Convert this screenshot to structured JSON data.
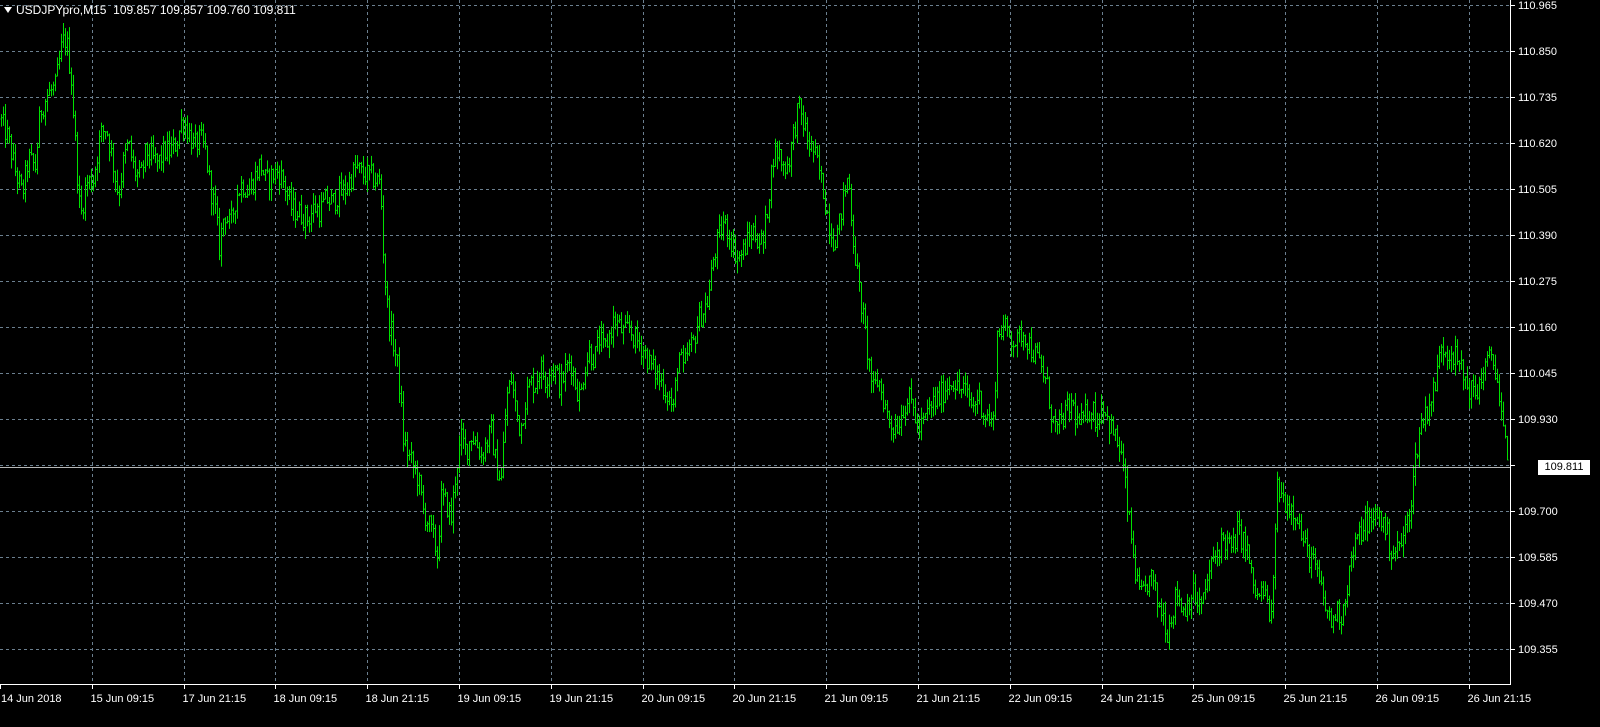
{
  "header": {
    "symbol": "USDJPYpro,M15",
    "ohlc": "109.857 109.857 109.760 109.811"
  },
  "colors": {
    "background": "#000000",
    "grid": "#6b7f8f",
    "candles": "#00e000",
    "axis_text": "#ffffff",
    "current_price_line": "#b8b8b8"
  },
  "chart_data": {
    "type": "bar",
    "instrument": "USDJPYpro",
    "timeframe": "M15",
    "ylim": [
      109.32,
      110.97
    ],
    "y_ticks": [
      "110.965",
      "110.850",
      "110.735",
      "110.620",
      "110.505",
      "110.390",
      "110.275",
      "110.160",
      "110.045",
      "109.930",
      "109.700",
      "109.585",
      "109.470",
      "109.355"
    ],
    "current_price": "109.811",
    "x_ticks": [
      "14 Jun 2018",
      "15 Jun 09:15",
      "17 Jun 21:15",
      "18 Jun 09:15",
      "18 Jun 21:15",
      "19 Jun 09:15",
      "19 Jun 21:15",
      "20 Jun 09:15",
      "20 Jun 21:15",
      "21 Jun 09:15",
      "21 Jun 21:15",
      "22 Jun 09:15",
      "24 Jun 21:15",
      "25 Jun 09:15",
      "25 Jun 21:15",
      "26 Jun 09:15",
      "26 Jun 21:15"
    ],
    "grid": true,
    "price_path": [
      [
        0,
        110.68
      ],
      [
        8,
        110.63
      ],
      [
        15,
        110.55
      ],
      [
        22,
        110.49
      ],
      [
        28,
        110.58
      ],
      [
        35,
        110.56
      ],
      [
        40,
        110.7
      ],
      [
        47,
        110.74
      ],
      [
        55,
        110.76
      ],
      [
        62,
        110.87
      ],
      [
        66,
        110.88
      ],
      [
        71,
        110.78
      ],
      [
        75,
        110.62
      ],
      [
        80,
        110.43
      ],
      [
        86,
        110.52
      ],
      [
        93,
        110.53
      ],
      [
        100,
        110.64
      ],
      [
        106,
        110.66
      ],
      [
        112,
        110.58
      ],
      [
        118,
        110.49
      ],
      [
        123,
        110.57
      ],
      [
        128,
        110.62
      ],
      [
        134,
        110.55
      ],
      [
        140,
        110.53
      ],
      [
        146,
        110.6
      ],
      [
        152,
        110.58
      ],
      [
        158,
        110.57
      ],
      [
        164,
        110.6
      ],
      [
        170,
        110.6
      ],
      [
        176,
        110.62
      ],
      [
        182,
        110.68
      ],
      [
        188,
        110.65
      ],
      [
        194,
        110.61
      ],
      [
        200,
        110.63
      ],
      [
        205,
        110.6
      ],
      [
        210,
        110.51
      ],
      [
        215,
        110.45
      ],
      [
        219,
        110.36
      ],
      [
        224,
        110.45
      ],
      [
        230,
        110.41
      ],
      [
        236,
        110.49
      ],
      [
        242,
        110.52
      ],
      [
        248,
        110.5
      ],
      [
        254,
        110.53
      ],
      [
        260,
        110.57
      ],
      [
        266,
        110.52
      ],
      [
        272,
        110.54
      ],
      [
        278,
        110.55
      ],
      [
        284,
        110.52
      ],
      [
        290,
        110.46
      ],
      [
        296,
        110.45
      ],
      [
        302,
        110.44
      ],
      [
        308,
        110.43
      ],
      [
        314,
        110.46
      ],
      [
        320,
        110.45
      ],
      [
        326,
        110.48
      ],
      [
        332,
        110.47
      ],
      [
        338,
        110.49
      ],
      [
        344,
        110.5
      ],
      [
        350,
        110.53
      ],
      [
        356,
        110.56
      ],
      [
        362,
        110.54
      ],
      [
        368,
        110.54
      ],
      [
        374,
        110.53
      ],
      [
        380,
        110.52
      ],
      [
        384,
        110.3
      ],
      [
        388,
        110.18
      ],
      [
        393,
        110.12
      ],
      [
        398,
        110.05
      ],
      [
        403,
        109.88
      ],
      [
        408,
        109.84
      ],
      [
        413,
        109.81
      ],
      [
        418,
        109.78
      ],
      [
        423,
        109.7
      ],
      [
        428,
        109.67
      ],
      [
        433,
        109.63
      ],
      [
        437,
        109.59
      ],
      [
        441,
        109.73
      ],
      [
        446,
        109.72
      ],
      [
        451,
        109.68
      ],
      [
        456,
        109.81
      ],
      [
        461,
        109.88
      ],
      [
        466,
        109.85
      ],
      [
        471,
        109.89
      ],
      [
        476,
        109.87
      ],
      [
        481,
        109.84
      ],
      [
        486,
        109.87
      ],
      [
        491,
        109.9
      ],
      [
        496,
        109.81
      ],
      [
        501,
        109.78
      ],
      [
        506,
        109.98
      ],
      [
        511,
        110.03
      ],
      [
        516,
        109.95
      ],
      [
        520,
        109.9
      ],
      [
        525,
        109.98
      ],
      [
        530,
        110.02
      ],
      [
        535,
        110.02
      ],
      [
        540,
        110.06
      ],
      [
        545,
        110.03
      ],
      [
        550,
        110.06
      ],
      [
        555,
        110.05
      ],
      [
        560,
        110.01
      ],
      [
        565,
        110.05
      ],
      [
        570,
        110.08
      ],
      [
        575,
        110.02
      ],
      [
        580,
        109.98
      ],
      [
        584,
        110.06
      ],
      [
        589,
        110.1
      ],
      [
        594,
        110.08
      ],
      [
        599,
        110.13
      ],
      [
        604,
        110.1
      ],
      [
        609,
        110.14
      ],
      [
        614,
        110.18
      ],
      [
        619,
        110.16
      ],
      [
        624,
        110.14
      ],
      [
        629,
        110.16
      ],
      [
        634,
        110.13
      ],
      [
        639,
        110.12
      ],
      [
        644,
        110.1
      ],
      [
        649,
        110.07
      ],
      [
        654,
        110.05
      ],
      [
        659,
        110.03
      ],
      [
        664,
        110.01
      ],
      [
        669,
        109.98
      ],
      [
        673,
        109.95
      ],
      [
        678,
        110.1
      ],
      [
        683,
        110.05
      ],
      [
        688,
        110.1
      ],
      [
        693,
        110.12
      ],
      [
        698,
        110.18
      ],
      [
        703,
        110.2
      ],
      [
        708,
        110.23
      ],
      [
        713,
        110.33
      ],
      [
        718,
        110.38
      ],
      [
        723,
        110.42
      ],
      [
        728,
        110.4
      ],
      [
        733,
        110.36
      ],
      [
        738,
        110.33
      ],
      [
        743,
        110.35
      ],
      [
        748,
        110.38
      ],
      [
        753,
        110.4
      ],
      [
        758,
        110.38
      ],
      [
        763,
        110.37
      ],
      [
        768,
        110.48
      ],
      [
        773,
        110.59
      ],
      [
        778,
        110.6
      ],
      [
        783,
        110.56
      ],
      [
        788,
        110.57
      ],
      [
        793,
        110.64
      ],
      [
        798,
        110.71
      ],
      [
        803,
        110.67
      ],
      [
        808,
        110.62
      ],
      [
        813,
        110.6
      ],
      [
        818,
        110.56
      ],
      [
        823,
        110.5
      ],
      [
        828,
        110.43
      ],
      [
        833,
        110.38
      ],
      [
        838,
        110.4
      ],
      [
        843,
        110.48
      ],
      [
        848,
        110.54
      ],
      [
        853,
        110.38
      ],
      [
        858,
        110.27
      ],
      [
        863,
        110.18
      ],
      [
        868,
        110.08
      ],
      [
        873,
        110.0
      ],
      [
        878,
        110.03
      ],
      [
        883,
        109.98
      ],
      [
        888,
        109.93
      ],
      [
        893,
        109.91
      ],
      [
        898,
        109.92
      ],
      [
        903,
        109.96
      ],
      [
        908,
        109.98
      ],
      [
        913,
        109.96
      ],
      [
        918,
        109.9
      ],
      [
        923,
        109.92
      ],
      [
        928,
        109.95
      ],
      [
        933,
        109.97
      ],
      [
        938,
        109.98
      ],
      [
        943,
        110.0
      ],
      [
        948,
        110.02
      ],
      [
        953,
        110.03
      ],
      [
        958,
        110.0
      ],
      [
        963,
        110.01
      ],
      [
        968,
        109.98
      ],
      [
        973,
        109.96
      ],
      [
        978,
        109.99
      ],
      [
        983,
        109.95
      ],
      [
        988,
        109.93
      ],
      [
        993,
        109.92
      ],
      [
        997,
        110.14
      ],
      [
        1002,
        110.16
      ],
      [
        1007,
        110.15
      ],
      [
        1012,
        110.13
      ],
      [
        1017,
        110.12
      ],
      [
        1022,
        110.15
      ],
      [
        1027,
        110.13
      ],
      [
        1032,
        110.1
      ],
      [
        1037,
        110.08
      ],
      [
        1042,
        110.05
      ],
      [
        1047,
        110.01
      ],
      [
        1052,
        109.93
      ],
      [
        1057,
        109.9
      ],
      [
        1062,
        109.93
      ],
      [
        1067,
        109.95
      ],
      [
        1072,
        109.97
      ],
      [
        1077,
        109.92
      ],
      [
        1082,
        109.92
      ],
      [
        1087,
        109.95
      ],
      [
        1092,
        109.96
      ],
      [
        1097,
        109.92
      ],
      [
        1102,
        109.98
      ],
      [
        1107,
        109.93
      ],
      [
        1112,
        109.9
      ],
      [
        1117,
        109.87
      ],
      [
        1122,
        109.83
      ],
      [
        1127,
        109.71
      ],
      [
        1132,
        109.61
      ],
      [
        1137,
        109.51
      ],
      [
        1142,
        109.48
      ],
      [
        1147,
        109.52
      ],
      [
        1152,
        109.53
      ],
      [
        1157,
        109.47
      ],
      [
        1162,
        109.45
      ],
      [
        1167,
        109.4
      ],
      [
        1172,
        109.45
      ],
      [
        1177,
        109.5
      ],
      [
        1182,
        109.45
      ],
      [
        1187,
        109.47
      ],
      [
        1192,
        109.5
      ],
      [
        1197,
        109.47
      ],
      [
        1202,
        109.46
      ],
      [
        1207,
        109.53
      ],
      [
        1212,
        109.57
      ],
      [
        1217,
        109.6
      ],
      [
        1222,
        109.63
      ],
      [
        1227,
        109.62
      ],
      [
        1232,
        109.6
      ],
      [
        1237,
        109.65
      ],
      [
        1242,
        109.63
      ],
      [
        1247,
        109.6
      ],
      [
        1252,
        109.52
      ],
      [
        1257,
        109.48
      ],
      [
        1262,
        109.5
      ],
      [
        1267,
        109.47
      ],
      [
        1272,
        109.42
      ],
      [
        1276,
        109.76
      ],
      [
        1281,
        109.74
      ],
      [
        1286,
        109.72
      ],
      [
        1291,
        109.71
      ],
      [
        1296,
        109.7
      ],
      [
        1301,
        109.64
      ],
      [
        1306,
        109.6
      ],
      [
        1311,
        109.58
      ],
      [
        1316,
        109.55
      ],
      [
        1321,
        109.5
      ],
      [
        1326,
        109.45
      ],
      [
        1331,
        109.42
      ],
      [
        1336,
        109.45
      ],
      [
        1341,
        109.44
      ],
      [
        1346,
        109.5
      ],
      [
        1351,
        109.58
      ],
      [
        1356,
        109.62
      ],
      [
        1361,
        109.65
      ],
      [
        1366,
        109.68
      ],
      [
        1371,
        109.66
      ],
      [
        1376,
        109.7
      ],
      [
        1381,
        109.68
      ],
      [
        1386,
        109.65
      ],
      [
        1391,
        109.6
      ],
      [
        1396,
        109.6
      ],
      [
        1401,
        109.62
      ],
      [
        1406,
        109.66
      ],
      [
        1411,
        109.73
      ],
      [
        1416,
        109.85
      ],
      [
        1421,
        109.92
      ],
      [
        1426,
        109.95
      ],
      [
        1431,
        109.98
      ],
      [
        1436,
        110.03
      ],
      [
        1441,
        110.12
      ],
      [
        1446,
        110.1
      ],
      [
        1451,
        110.1
      ],
      [
        1456,
        110.08
      ],
      [
        1461,
        110.05
      ],
      [
        1466,
        110.02
      ],
      [
        1471,
        110.0
      ],
      [
        1476,
        109.99
      ],
      [
        1481,
        110.04
      ],
      [
        1486,
        110.06
      ],
      [
        1491,
        110.09
      ],
      [
        1496,
        110.05
      ],
      [
        1500,
        109.95
      ],
      [
        1504,
        109.88
      ],
      [
        1507,
        109.81
      ]
    ]
  }
}
